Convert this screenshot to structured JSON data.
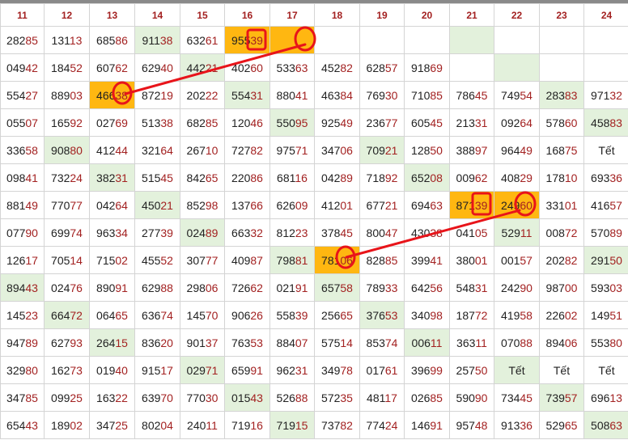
{
  "columns": [
    "11",
    "12",
    "13",
    "14",
    "15",
    "16",
    "17",
    "18",
    "19",
    "20",
    "21",
    "22",
    "23",
    "24"
  ],
  "rows": [
    [
      "28285",
      "13113",
      "68586",
      "91138",
      "63261",
      "95539",
      "",
      "",
      "",
      "",
      "",
      "",
      "",
      ""
    ],
    [
      "04942",
      "18452",
      "60762",
      "62940",
      "44221",
      "40260",
      "53363",
      "45282",
      "62857",
      "91869",
      "",
      "",
      "",
      ""
    ],
    [
      "55427",
      "88903",
      "46638",
      "87219",
      "20222",
      "55431",
      "88041",
      "46384",
      "76930",
      "71085",
      "78645",
      "74954",
      "28383",
      "97132"
    ],
    [
      "05507",
      "16592",
      "02769",
      "51338",
      "68285",
      "12046",
      "55095",
      "92549",
      "23677",
      "60545",
      "21331",
      "09264",
      "57860",
      "45883"
    ],
    [
      "33658",
      "90880",
      "41244",
      "32164",
      "26710",
      "72782",
      "97571",
      "34706",
      "70921",
      "12850",
      "38897",
      "96449",
      "16875",
      "Tết"
    ],
    [
      "09841",
      "73224",
      "38231",
      "51545",
      "84265",
      "22086",
      "68116",
      "04289",
      "71892",
      "65208",
      "00962",
      "40829",
      "17810",
      "69336"
    ],
    [
      "88149",
      "77077",
      "04264",
      "45021",
      "85298",
      "13766",
      "62609",
      "41201",
      "67721",
      "69463",
      "87139",
      "24960",
      "33101",
      "41657"
    ],
    [
      "07790",
      "69974",
      "96334",
      "27739",
      "02489",
      "66332",
      "81223",
      "37845",
      "80047",
      "43038",
      "04105",
      "52911",
      "00872",
      "57089"
    ],
    [
      "12617",
      "70514",
      "71502",
      "45552",
      "30777",
      "40987",
      "79881",
      "78106",
      "82885",
      "39941",
      "38001",
      "00157",
      "20282",
      "29150"
    ],
    [
      "89443",
      "02476",
      "89091",
      "62988",
      "29806",
      "72662",
      "02191",
      "65758",
      "78933",
      "64256",
      "54831",
      "24290",
      "98700",
      "59303"
    ],
    [
      "14523",
      "66472",
      "06465",
      "63674",
      "14570",
      "90626",
      "55839",
      "25665",
      "37653",
      "34098",
      "18772",
      "41958",
      "22602",
      "14951"
    ],
    [
      "94789",
      "62793",
      "26415",
      "83620",
      "90137",
      "76353",
      "88407",
      "57514",
      "85374",
      "00611",
      "36311",
      "07088",
      "89406",
      "55380"
    ],
    [
      "32980",
      "16273",
      "01940",
      "91517",
      "02971",
      "65991",
      "96231",
      "34978",
      "01761",
      "39699",
      "25750",
      "Tết",
      "Tết",
      "Tết"
    ],
    [
      "34785",
      "09925",
      "16322",
      "63970",
      "77030",
      "01543",
      "52688",
      "57235",
      "48117",
      "02685",
      "59090",
      "73445",
      "73957",
      "69613"
    ],
    [
      "65443",
      "18902",
      "34725",
      "80204",
      "24011",
      "71916",
      "71915",
      "73782",
      "77424",
      "14691",
      "95748",
      "91336",
      "52965",
      "50863"
    ]
  ],
  "green_cells": [
    [
      0,
      3
    ],
    [
      0,
      10
    ],
    [
      1,
      4
    ],
    [
      1,
      11
    ],
    [
      2,
      5
    ],
    [
      2,
      12
    ],
    [
      3,
      6
    ],
    [
      3,
      13
    ],
    [
      4,
      1
    ],
    [
      4,
      8
    ],
    [
      5,
      2
    ],
    [
      5,
      9
    ],
    [
      6,
      3
    ],
    [
      6,
      10
    ],
    [
      7,
      4
    ],
    [
      7,
      11
    ],
    [
      8,
      6
    ],
    [
      8,
      13
    ],
    [
      9,
      0
    ],
    [
      9,
      7
    ],
    [
      10,
      1
    ],
    [
      10,
      8
    ],
    [
      11,
      2
    ],
    [
      11,
      9
    ],
    [
      12,
      4
    ],
    [
      12,
      11
    ],
    [
      13,
      5
    ],
    [
      13,
      12
    ],
    [
      14,
      6
    ],
    [
      14,
      13
    ]
  ],
  "orange_cells": [
    [
      0,
      5
    ],
    [
      0,
      6
    ],
    [
      2,
      2
    ],
    [
      6,
      10
    ],
    [
      6,
      11
    ],
    [
      8,
      7
    ]
  ],
  "colors": {
    "header_text": "#a32121",
    "cell_text": "#222222",
    "last_two_digits": "#a32121",
    "green_highlight": "#e3f1dc",
    "orange_highlight": "#ffb711",
    "annotation": "#e8141a",
    "grid_line": "#d4d4d4"
  }
}
